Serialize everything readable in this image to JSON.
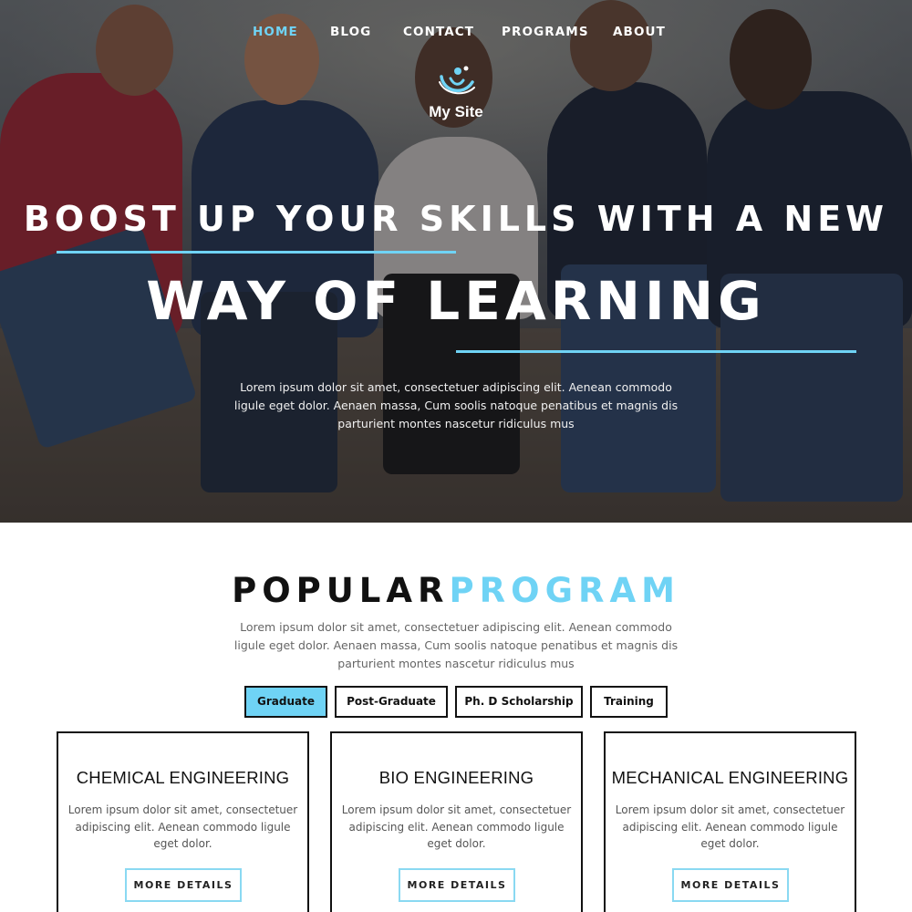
{
  "nav": {
    "items": [
      {
        "label": "HOME",
        "active": true
      },
      {
        "label": "BLOG",
        "active": false
      },
      {
        "label": "CONTACT",
        "active": false
      },
      {
        "label": "PROGRAMS",
        "active": false
      },
      {
        "label": "ABOUT",
        "active": false
      }
    ]
  },
  "brand": {
    "logo_icon": "people-swirl-icon",
    "name": "My Site"
  },
  "hero": {
    "line1": "BOOST UP YOUR SKILLS WITH A NEW",
    "line2": "WAY OF LEARNING",
    "description": "Lorem ipsum dolor sit amet, consectetuer adipiscing elit. Aenean commodo ligule eget dolor. Aenaen massa, Cum soolis natoque penatibus et magnis dis parturient montes nascetur ridiculus mus"
  },
  "programs": {
    "title_dark": "POPULAR",
    "title_light": "PROGRAM",
    "description": "Lorem ipsum dolor sit amet, consectetuer adipiscing elit. Aenean commodo ligule eget dolor. Aenaen massa, Cum soolis natoque penatibus et magnis dis parturient montes nascetur ridiculus mus",
    "tabs": [
      {
        "label": "Graduate",
        "active": true
      },
      {
        "label": "Post-Graduate",
        "active": false
      },
      {
        "label": "Ph. D Scholarship",
        "active": false
      },
      {
        "label": "Training",
        "active": false
      }
    ],
    "cards": [
      {
        "title": "CHEMICAL ENGINEERING",
        "description": "Lorem ipsum dolor sit amet, consectetuer adipiscing elit. Aenean commodo ligule eget dolor.",
        "button": "MORE DETAILS"
      },
      {
        "title": "BIO ENGINEERING",
        "description": "Lorem ipsum dolor sit amet, consectetuer adipiscing elit. Aenean commodo ligule eget dolor.",
        "button": "MORE DETAILS"
      },
      {
        "title": "MECHANICAL ENGINEERING",
        "description": "Lorem ipsum dolor sit amet, consectetuer adipiscing elit. Aenean commodo ligule eget dolor.",
        "button": "MORE DETAILS"
      }
    ]
  },
  "colors": {
    "accent": "#6fd3f5",
    "dark": "#111111"
  }
}
